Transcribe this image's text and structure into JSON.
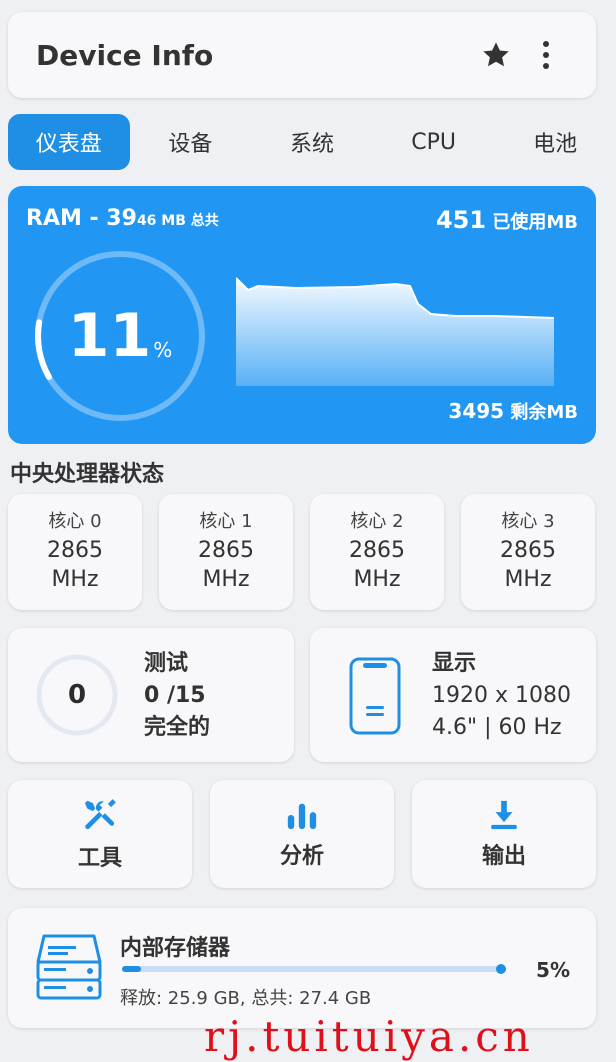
{
  "app": {
    "title": "Device Info"
  },
  "tabs": [
    {
      "label": "仪表盘",
      "active": true
    },
    {
      "label": "设备"
    },
    {
      "label": "系统"
    },
    {
      "label": "CPU"
    },
    {
      "label": "电池"
    }
  ],
  "ram": {
    "prefix": "RAM - 39",
    "total_suffix": "46 MB 总共",
    "used_value": "451",
    "used_label": " 已使用MB",
    "free_value": "3495",
    "free_label": " 剩余MB",
    "percent": "11",
    "percent_unit": "%",
    "usage_fraction": 0.11
  },
  "cpu": {
    "title": "中央处理器状态",
    "cores": [
      {
        "label": "核心 0",
        "freq": "2865",
        "unit": "MHz"
      },
      {
        "label": "核心 1",
        "freq": "2865",
        "unit": "MHz"
      },
      {
        "label": "核心 2",
        "freq": "2865",
        "unit": "MHz"
      },
      {
        "label": "核心 3",
        "freq": "2865",
        "unit": "MHz"
      }
    ]
  },
  "test": {
    "count": "0",
    "title": "测试",
    "progress": "0 /15",
    "status": "完全的"
  },
  "display": {
    "title": "显示",
    "resolution": "1920 x 1080",
    "info": "4.6\" | 60 Hz"
  },
  "tools": [
    {
      "label": "工具",
      "icon": "tools-icon"
    },
    {
      "label": "分析",
      "icon": "bar-chart-icon"
    },
    {
      "label": "输出",
      "icon": "download-icon"
    }
  ],
  "storage": {
    "title": "内部存储器",
    "percent": "5%",
    "usage_fraction": 0.05,
    "details": "释放: 25.9 GB, 总共: 27.4 GB"
  },
  "watermark": "rj.tuituiya.cn",
  "colors": {
    "accent": "#2196f3",
    "tab_active": "#1f8fe5",
    "background": "#eef0f3"
  }
}
